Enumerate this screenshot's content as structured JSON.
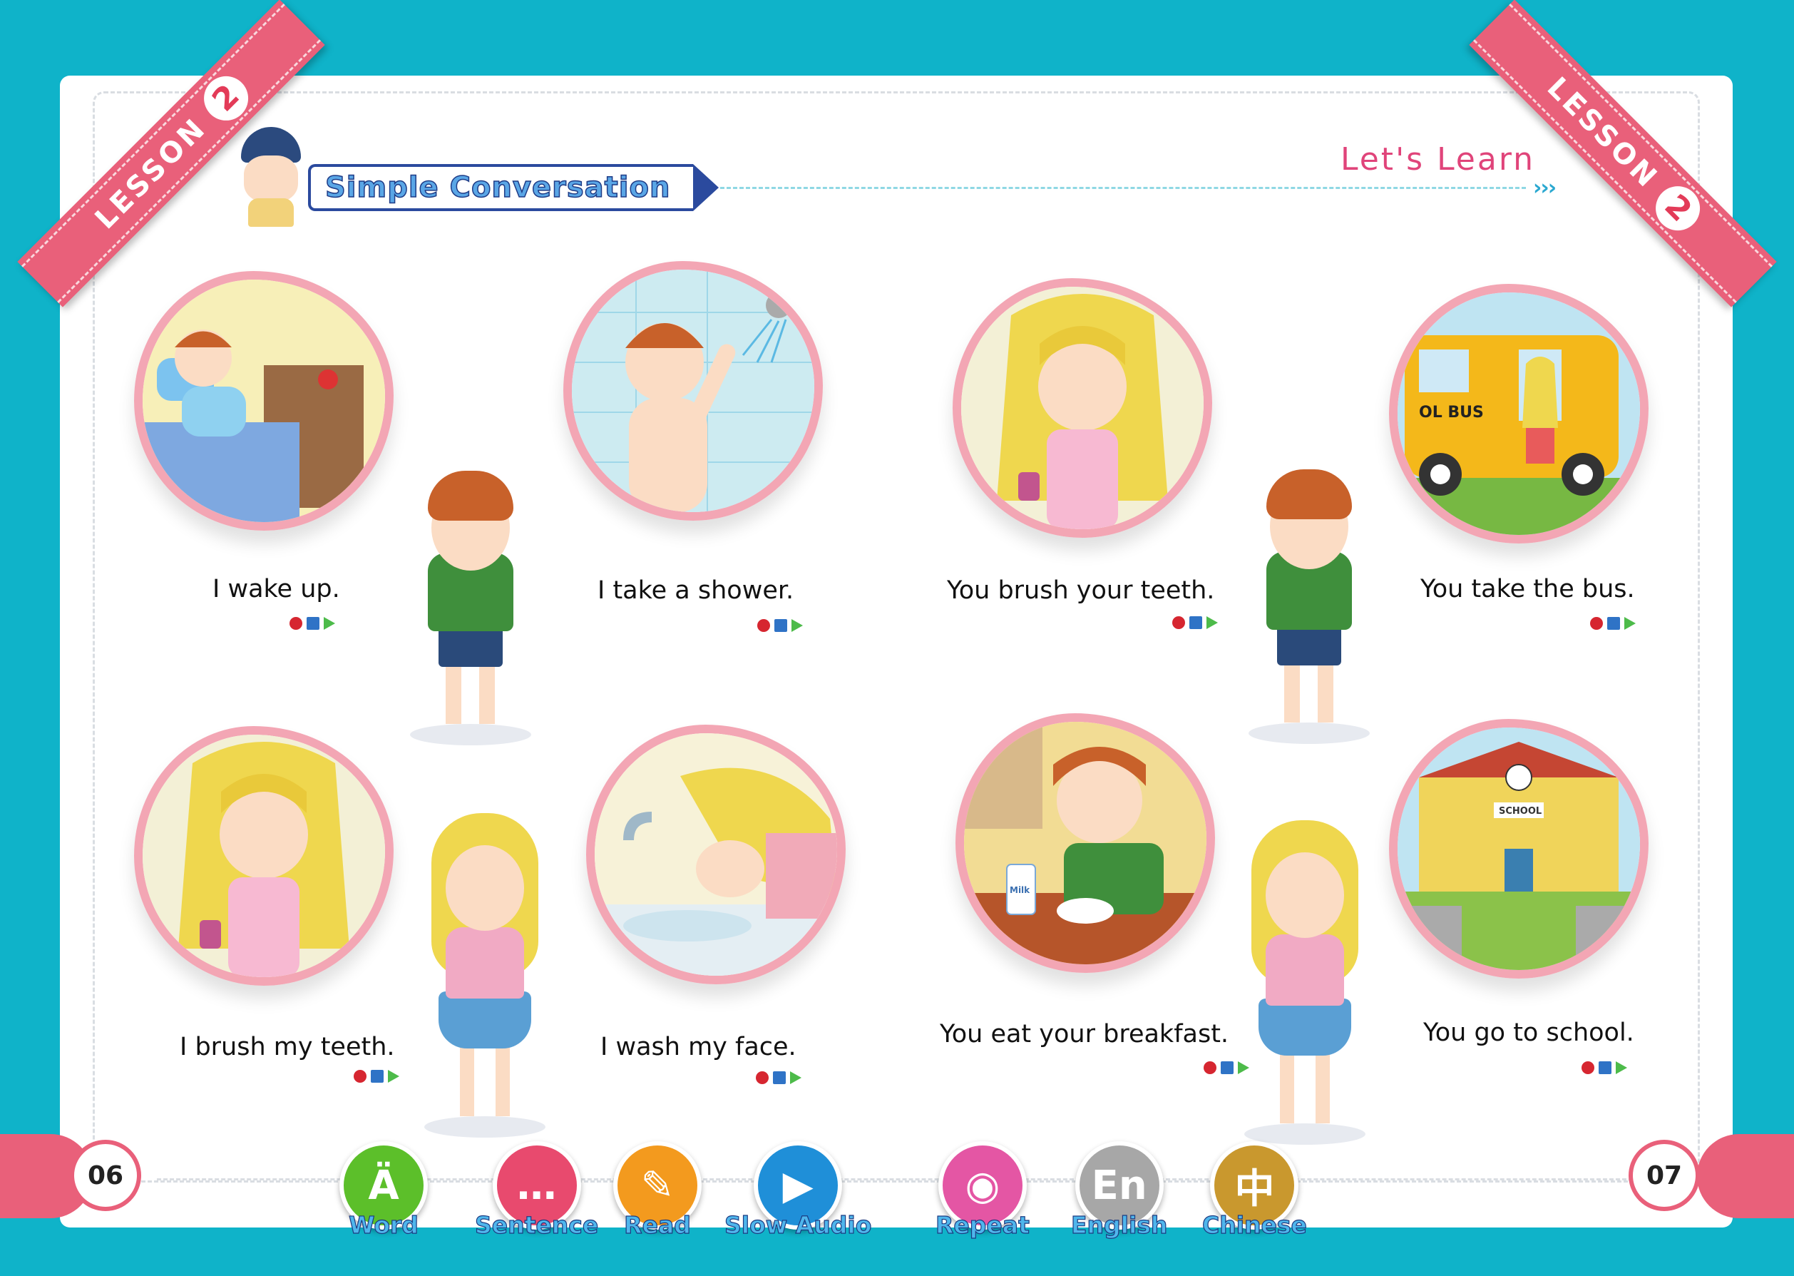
{
  "lesson": {
    "label": "LESSON",
    "number": "2"
  },
  "header": {
    "title": "Simple Conversation",
    "section": "Let's Learn"
  },
  "items": [
    {
      "sentence": "I wake up."
    },
    {
      "sentence": "I take a shower."
    },
    {
      "sentence": "You brush your teeth."
    },
    {
      "sentence": "You take the bus."
    },
    {
      "sentence": "I brush my teeth."
    },
    {
      "sentence": "I wash my face."
    },
    {
      "sentence": "You eat your breakfast."
    },
    {
      "sentence": "You go to school."
    }
  ],
  "scene_text": {
    "bus": "OL BUS",
    "school": "SCHOOL",
    "milk": "Milk"
  },
  "pages": {
    "left": "06",
    "right": "07"
  },
  "toolbar": [
    {
      "label": "Word",
      "icon": "word-icon",
      "glyph": "Ä",
      "color": "#5cbf2a"
    },
    {
      "label": "Sentence",
      "icon": "speech-bubble-icon",
      "glyph": "…",
      "color": "#e84a6e"
    },
    {
      "label": "Read",
      "icon": "book-pencil-icon",
      "glyph": "✎",
      "color": "#f39a1e"
    },
    {
      "label": "Slow Audio",
      "icon": "slow-play-icon",
      "glyph": "▶",
      "color": "#1f8fd8"
    },
    {
      "label": "Repeat",
      "icon": "microphone-icon",
      "glyph": "◉",
      "color": "#e456a4"
    },
    {
      "label": "English",
      "icon": "english-icon",
      "glyph": "En",
      "color": "#a7a7a7"
    },
    {
      "label": "Chinese",
      "icon": "chinese-icon",
      "glyph": "中",
      "color": "#c9982e"
    }
  ],
  "colors": {
    "frame": "#0fb3c9",
    "ribbon": "#e9607a",
    "bubble_border": "#f3a6b4"
  }
}
